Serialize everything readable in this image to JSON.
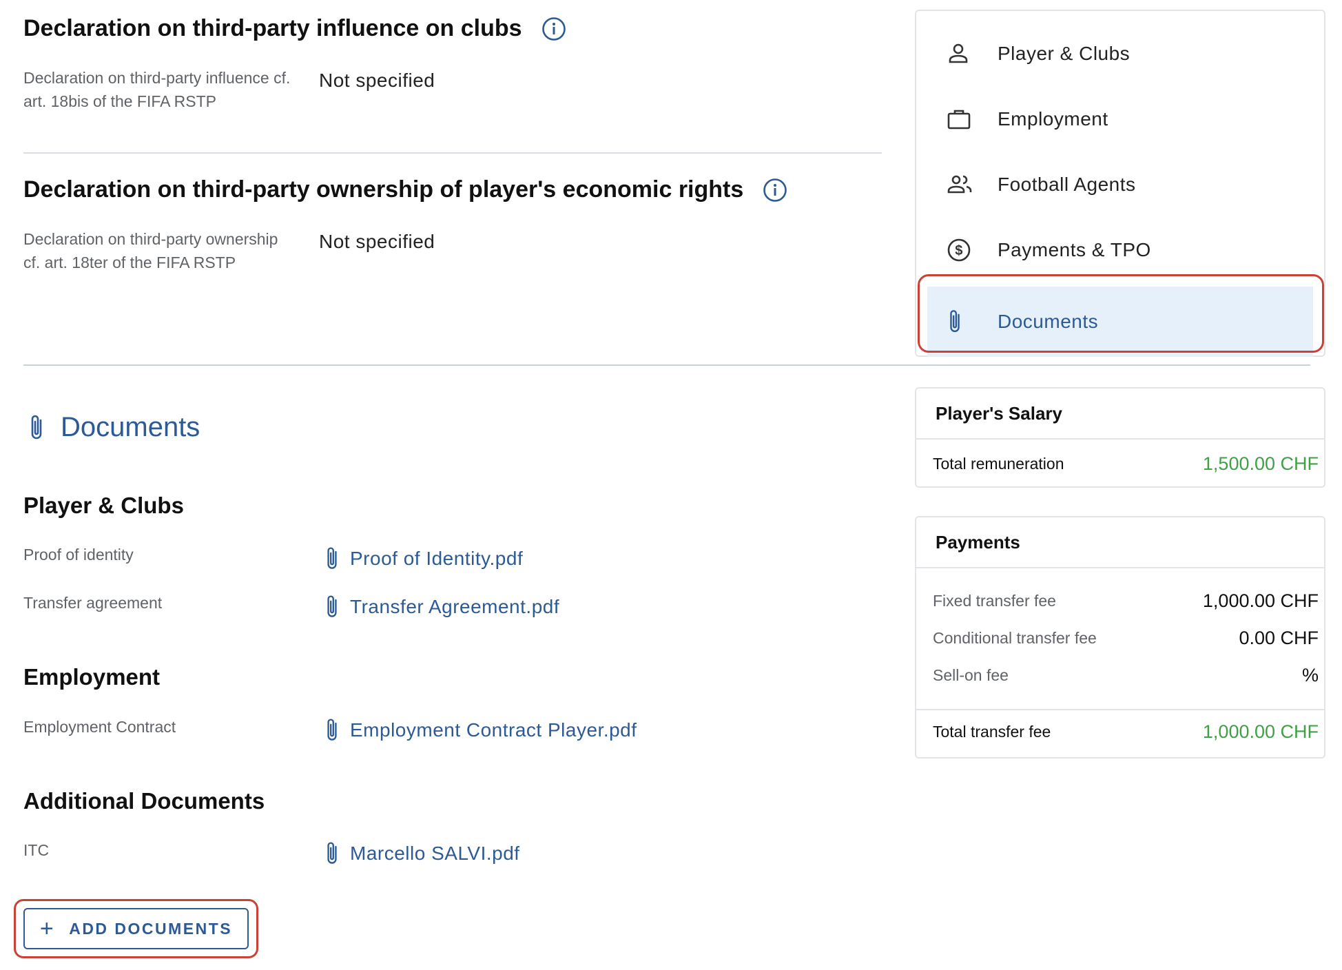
{
  "declarations": [
    {
      "title": "Declaration on third-party influence on clubs",
      "label": "Declaration on third-party influence cf. art. 18bis of the FIFA RSTP",
      "value": "Not specified"
    },
    {
      "title": "Declaration on third-party ownership of player's economic rights",
      "label": "Declaration on third-party ownership cf. art. 18ter of the FIFA RSTP",
      "value": "Not specified"
    }
  ],
  "documents": {
    "heading": "Documents",
    "groups": [
      {
        "title": "Player & Clubs",
        "items": [
          {
            "label": "Proof of identity",
            "file": "Proof of Identity.pdf"
          },
          {
            "label": "Transfer agreement",
            "file": "Transfer Agreement.pdf"
          }
        ]
      },
      {
        "title": "Employment",
        "items": [
          {
            "label": "Employment Contract",
            "file": "Employment Contract Player.pdf"
          }
        ]
      },
      {
        "title": "Additional Documents",
        "items": [
          {
            "label": "ITC",
            "file": "Marcello SALVI.pdf"
          }
        ]
      }
    ],
    "add_button": "ADD DOCUMENTS"
  },
  "nav": {
    "items": [
      {
        "label": "Player & Clubs",
        "icon": "person-icon"
      },
      {
        "label": "Employment",
        "icon": "briefcase-icon"
      },
      {
        "label": "Football Agents",
        "icon": "group-icon"
      },
      {
        "label": "Payments & TPO",
        "icon": "dollar-circle-icon"
      },
      {
        "label": "Documents",
        "icon": "paperclip-icon",
        "active": true
      }
    ]
  },
  "salary_card": {
    "title": "Player's Salary",
    "total_label": "Total remuneration",
    "total_value": "1,500.00 CHF"
  },
  "payments_card": {
    "title": "Payments",
    "rows": [
      {
        "label": "Fixed transfer fee",
        "value": "1,000.00 CHF"
      },
      {
        "label": "Conditional transfer fee",
        "value": "0.00 CHF"
      },
      {
        "label": "Sell-on fee",
        "value": "%"
      }
    ],
    "total_label": "Total transfer fee",
    "total_value": "1,000.00 CHF"
  },
  "colors": {
    "accent": "#2c5a96",
    "highlight_outline": "#c94235",
    "active_bg": "#e6f0fb",
    "positive": "#3fa045"
  }
}
